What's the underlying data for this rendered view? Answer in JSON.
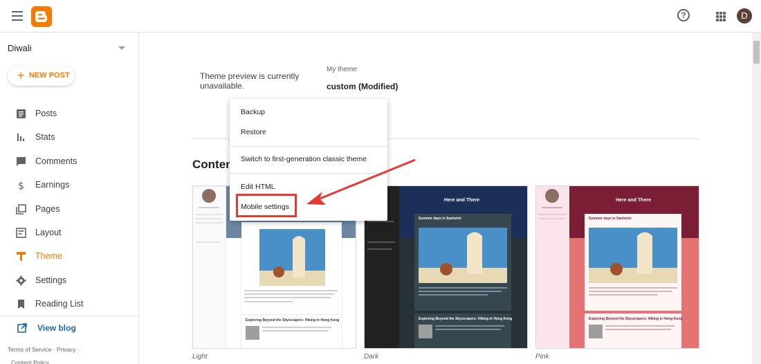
{
  "topbar": {
    "menu_icon": "hamburger-icon",
    "logo_icon": "blogger-logo",
    "help_icon": "help-icon",
    "apps_icon": "apps-grid-icon",
    "avatar_letter": "D"
  },
  "sidebar": {
    "blog_name": "Diwali",
    "new_post_label": "NEW POST",
    "items": [
      {
        "label": "Posts",
        "icon": "posts-icon"
      },
      {
        "label": "Stats",
        "icon": "stats-icon"
      },
      {
        "label": "Comments",
        "icon": "comments-icon"
      },
      {
        "label": "Earnings",
        "icon": "earnings-icon"
      },
      {
        "label": "Pages",
        "icon": "pages-icon"
      },
      {
        "label": "Layout",
        "icon": "layout-icon"
      },
      {
        "label": "Theme",
        "icon": "theme-icon",
        "active": true
      },
      {
        "label": "Settings",
        "icon": "settings-icon"
      },
      {
        "label": "Reading List",
        "icon": "reading-list-icon"
      }
    ],
    "view_blog_label": "View blog",
    "footer_line1": "Terms of Service · Privacy ·",
    "footer_line2": "Content Policy",
    "accent_color": "#f57c00"
  },
  "main": {
    "preview_message": "Theme preview is currently unavailable.",
    "my_theme_label": "My theme",
    "my_theme_name": "custom (Modified)",
    "section_title": "Conten",
    "themes": [
      {
        "label": "Light",
        "banner_title": "",
        "post_title": "",
        "post2_title": "Exploring Beyond the Skyscrapers: Hiking in Hong Kong"
      },
      {
        "label": "Dark",
        "banner_title": "Here and There",
        "post_title": "Summer days in Santorini",
        "post2_title": "Exploring Beyond the Skyscrapers: Hiking in Hong Kong"
      },
      {
        "label": "Pink",
        "banner_title": "Here and There",
        "post_title": "Summer days in Santorini",
        "post2_title": "Exploring Beyond the Skyscrapers: Hiking in Hong Kong"
      }
    ]
  },
  "menu": {
    "items": [
      {
        "label": "Backup"
      },
      {
        "label": "Restore"
      },
      {
        "label": "Switch to first-generation classic theme"
      },
      {
        "label": "Edit HTML"
      },
      {
        "label": "Mobile settings",
        "highlighted": true
      }
    ],
    "highlight_color": "#e53935"
  }
}
